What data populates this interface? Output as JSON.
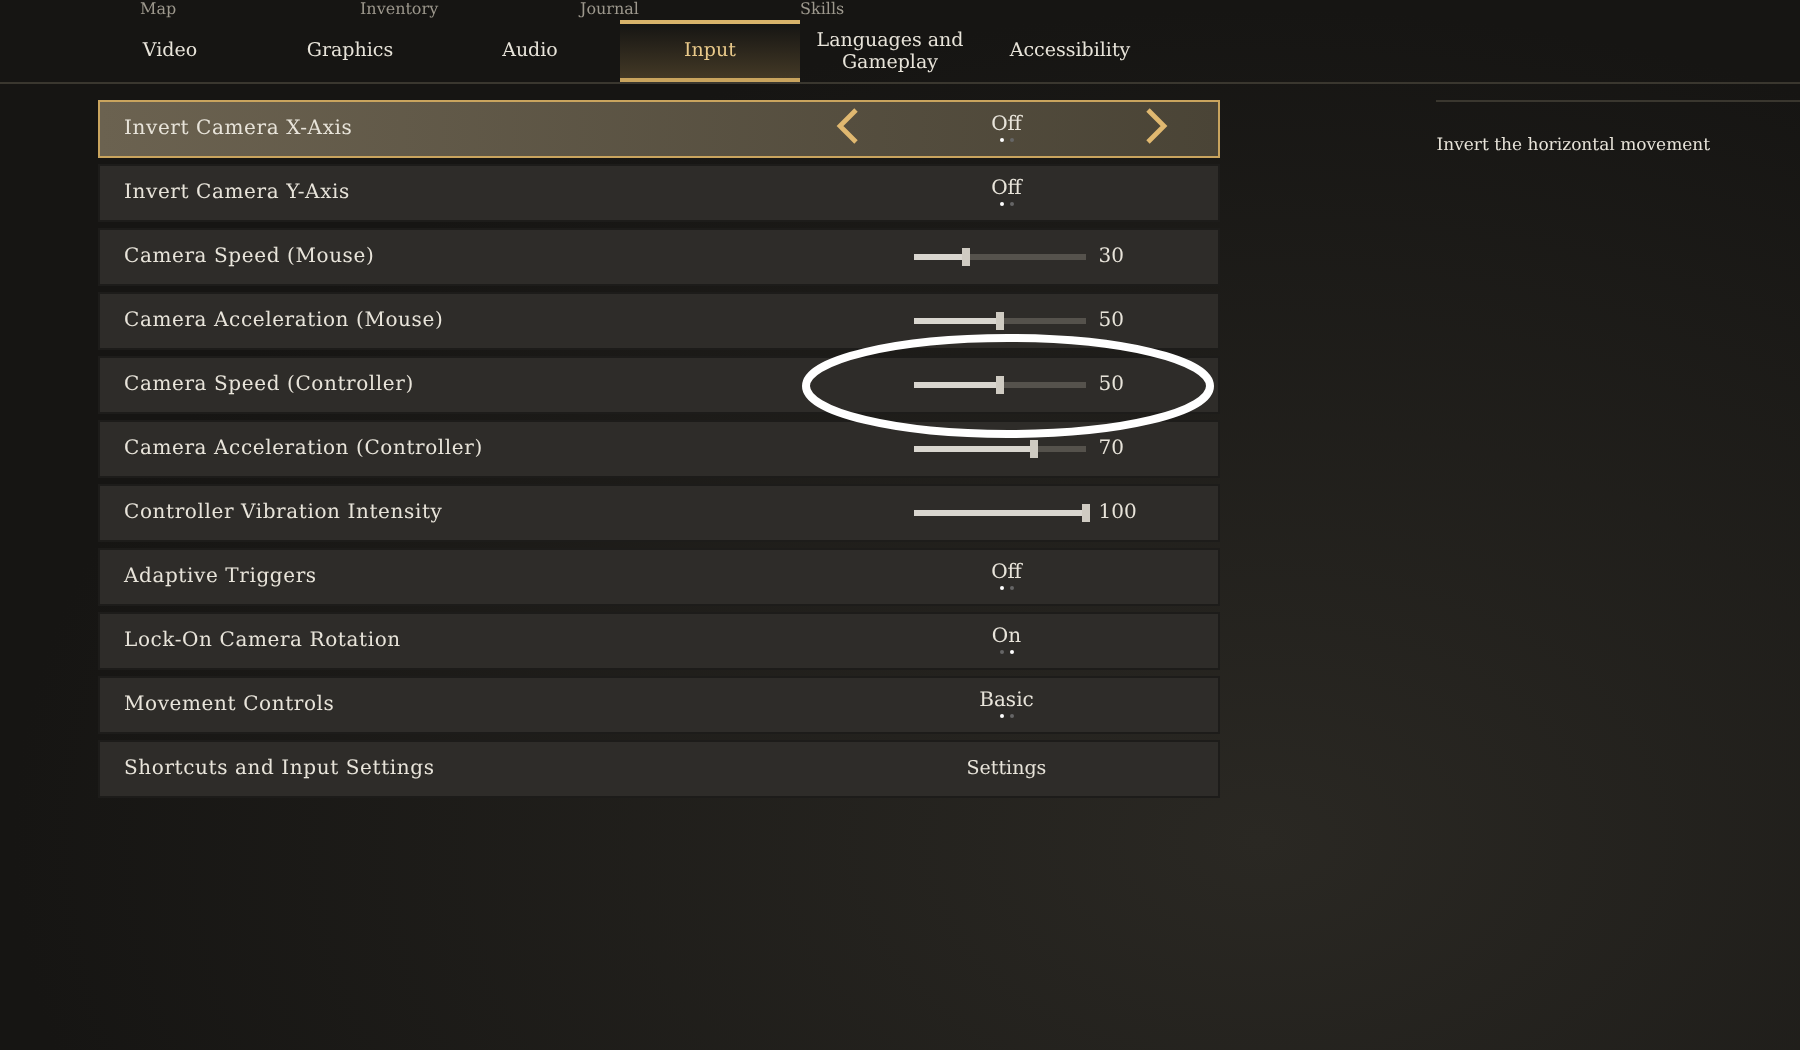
{
  "top_menu": [
    "Map",
    "Inventory",
    "Journal",
    "Skills"
  ],
  "tabs": [
    {
      "label": "Video",
      "selected": false
    },
    {
      "label": "Graphics",
      "selected": false
    },
    {
      "label": "Audio",
      "selected": false
    },
    {
      "label": "Input",
      "selected": true
    },
    {
      "label": "Languages and Gameplay",
      "selected": false
    },
    {
      "label": "Accessibility",
      "selected": false
    }
  ],
  "settings": [
    {
      "kind": "choice",
      "label": "Invert Camera X-Axis",
      "value": "Off",
      "focused": true,
      "dots": [
        {
          "selected": true
        },
        {
          "selected": false
        }
      ]
    },
    {
      "kind": "choice",
      "label": "Invert Camera Y-Axis",
      "value": "Off",
      "focused": false,
      "dots": [
        {
          "selected": true
        },
        {
          "selected": false
        }
      ]
    },
    {
      "kind": "slider",
      "label": "Camera Speed (Mouse)",
      "level": 0.3,
      "reading": "30",
      "focused": false
    },
    {
      "kind": "slider",
      "label": "Camera Acceleration (Mouse)",
      "level": 0.5,
      "reading": "50",
      "focused": false
    },
    {
      "kind": "slider",
      "label": "Camera Speed (Controller)",
      "level": 0.5,
      "reading": "50",
      "focused": false,
      "circled": true
    },
    {
      "kind": "slider",
      "label": "Camera Acceleration (Controller)",
      "level": 0.7,
      "reading": "70",
      "focused": false
    },
    {
      "kind": "slider",
      "label": "Controller Vibration Intensity",
      "level": 1,
      "reading": "100",
      "focused": false
    },
    {
      "kind": "choice",
      "label": "Adaptive Triggers",
      "value": "Off",
      "focused": false,
      "dots": [
        {
          "selected": true
        },
        {
          "selected": false
        }
      ]
    },
    {
      "kind": "choice",
      "label": "Lock-On Camera Rotation",
      "value": "On",
      "focused": false,
      "dots": [
        {
          "selected": false
        },
        {
          "selected": true
        }
      ]
    },
    {
      "kind": "choice",
      "label": "Movement Controls",
      "value": "Basic",
      "focused": false,
      "dots": [
        {
          "selected": true
        },
        {
          "selected": false
        }
      ]
    },
    {
      "kind": "button",
      "label": "Shortcuts and Input Settings",
      "value": "Settings",
      "focused": false
    }
  ],
  "description": "Invert the horizontal movement"
}
